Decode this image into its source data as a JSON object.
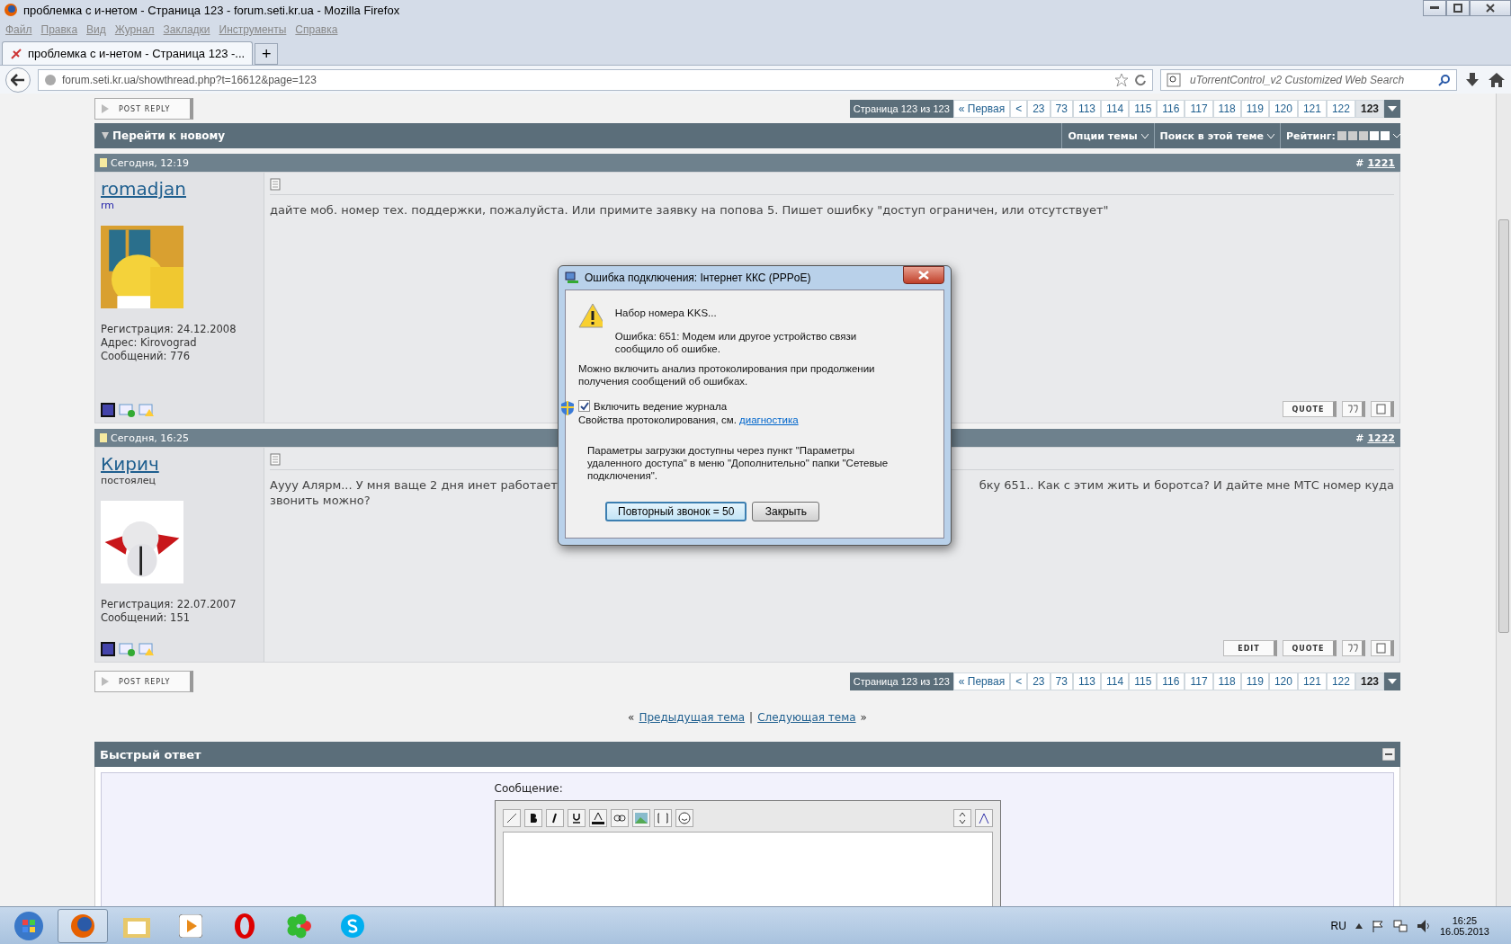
{
  "window": {
    "title": "проблемка с и-нетом - Страница 123 - forum.seti.kr.ua - Mozilla Firefox"
  },
  "menu": [
    "Файл",
    "Правка",
    "Вид",
    "Журнал",
    "Закладки",
    "Инструменты",
    "Справка"
  ],
  "tabs": [
    {
      "label": "проблемка с и-нетом - Страница 123 -...",
      "selected": true
    }
  ],
  "new_tab": "+",
  "address": {
    "value": "forum.seti.kr.ua/showthread.php?t=16612&page=123"
  },
  "search": {
    "placeholder": "uTorrentControl_v2 Customized Web Search"
  },
  "top_bar": {
    "post_reply": "POST REPLY",
    "page_label": "Страница 123 из 123",
    "pages": [
      {
        "label": "« Первая",
        "selected": false
      },
      {
        "label": "<",
        "selected": false
      },
      {
        "label": "23",
        "selected": false
      },
      {
        "label": "73",
        "selected": false
      },
      {
        "label": "113",
        "selected": false
      },
      {
        "label": "114",
        "selected": false
      },
      {
        "label": "115",
        "selected": false
      },
      {
        "label": "116",
        "selected": false
      },
      {
        "label": "117",
        "selected": false
      },
      {
        "label": "118",
        "selected": false
      },
      {
        "label": "119",
        "selected": false
      },
      {
        "label": "120",
        "selected": false
      },
      {
        "label": "121",
        "selected": false
      },
      {
        "label": "122",
        "selected": false
      },
      {
        "label": "123",
        "selected": true
      }
    ]
  },
  "thread_bar": {
    "title": "Перейти к новому",
    "tools": [
      "Опции темы",
      "Поиск в этой теме"
    ],
    "rating_label": "Рейтинг:"
  },
  "posts": [
    {
      "date": "Сегодня, 12:19",
      "hash": "#",
      "number": "1221",
      "username": "romadjan",
      "user_title": "rm",
      "info": [
        "Регистрация: 24.12.2008",
        "Адрес: Kirovograd",
        "Сообщений: 776"
      ],
      "text_lines": [
        [
          "дайте моб. номер тех. поддержки, пожалуйста. Или примите заявку на попова 5. Пишет ошибку \"доступ ограничен, или отсутствует\""
        ]
      ],
      "buttons": [
        "QUOTE"
      ]
    },
    {
      "date": "Сегодня, 16:25",
      "hash": "#",
      "number": "1222",
      "username": "Кирич",
      "user_title": "постоялец",
      "info": [
        "Регистрация: 22.07.2007",
        "Сообщений: 151"
      ],
      "text_lines": [
        [
          "Аууу Алярм... У мня ваще 2 дня инет работает",
          "бку 651.. Как с этим жить и боротса? И дайте мне МТС номер куда"
        ],
        [
          "звонить можно?"
        ]
      ],
      "buttons": [
        "EDIT",
        "QUOTE"
      ]
    }
  ],
  "bottom_bar": {
    "post_reply": "POST REPLY",
    "page_label": "Страница 123 из 123",
    "pages": [
      {
        "label": "« Первая",
        "selected": false
      },
      {
        "label": "<",
        "selected": false
      },
      {
        "label": "23",
        "selected": false
      },
      {
        "label": "73",
        "selected": false
      },
      {
        "label": "113",
        "selected": false
      },
      {
        "label": "114",
        "selected": false
      },
      {
        "label": "115",
        "selected": false
      },
      {
        "label": "116",
        "selected": false
      },
      {
        "label": "117",
        "selected": false
      },
      {
        "label": "118",
        "selected": false
      },
      {
        "label": "119",
        "selected": false
      },
      {
        "label": "120",
        "selected": false
      },
      {
        "label": "121",
        "selected": false
      },
      {
        "label": "122",
        "selected": false
      },
      {
        "label": "123",
        "selected": true
      }
    ]
  },
  "thread_nav": {
    "left": "«",
    "prev": "Предыдущая тема",
    "separator": "|",
    "next": "Следующая тема",
    "right": "»"
  },
  "quick_reply": {
    "title": "Быстрый ответ",
    "message_label": "Сообщение:"
  },
  "dialog": {
    "title": "Ошибка подключения: Інтернет ККС (PPPoE)",
    "heading": "Набор номера KKS...",
    "error": "Ошибка: 651: Модем или другое устройство связи сообщило об ошибке.",
    "hint": "Можно включить анализ протоколирования при продолжении получения сообщений об ошибках.",
    "log_label": "Включить ведение журнала",
    "log_checked": true,
    "props_text": "Свойства протоколирования, см.",
    "props_link": "диагностика",
    "params": "Параметры загрузки доступны через пункт \"Параметры удаленного доступа\" в меню \"Дополнительно\" папки \"Сетевые подключения\".",
    "buttons": [
      {
        "label": "Повторный звонок = 50",
        "default": true
      },
      {
        "label": "Закрыть",
        "default": false
      }
    ]
  },
  "taskbar": {
    "language": "RU",
    "time": "16:25",
    "date": "16.05.2013"
  }
}
